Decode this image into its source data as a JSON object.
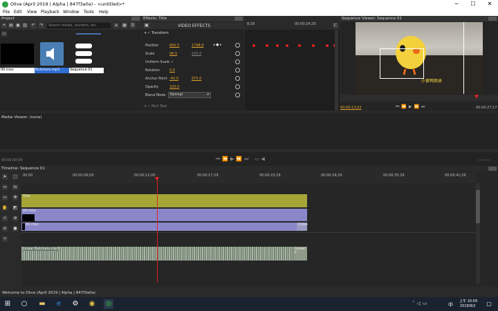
{
  "window": {
    "title": "Olive (April 2019 | Alpha | 847f3a0a) - <untitled>*",
    "minimize": "─",
    "maximize": "☐",
    "close": "✕"
  },
  "menu": [
    "File",
    "Edit",
    "View",
    "Playback",
    "Window",
    "Tools",
    "Help"
  ],
  "project": {
    "title": "Project",
    "search_placeholder": "Search media, markers, etc.",
    "items": [
      "00.mov",
      "Butchers.mp3",
      "Sequence 01"
    ]
  },
  "effects": {
    "title": "Effects: Title",
    "header": "VIDEO EFFECTS",
    "transform_label": "Transform",
    "rows": [
      {
        "label": "Position",
        "v1": "695.5",
        "v2": "1798.0"
      },
      {
        "label": "Scale",
        "v1": "96.5",
        "v2": "100.0"
      },
      {
        "label": "Uniform Scale",
        "v1": "✓",
        "v2": ""
      },
      {
        "label": "Rotation",
        "v1": "0.0",
        "v2": ""
      },
      {
        "label": "Anchor Point",
        "v1": "-40.0",
        "v2": "875.0"
      },
      {
        "label": "Opacity",
        "v1": "100.0",
        "v2": ""
      },
      {
        "label": "Blend Mode",
        "v1": "Normal",
        "v2": ""
      }
    ],
    "next_effect": "Rich Text",
    "ruler_start": "8;29",
    "ruler_mid": "00:00:24;29"
  },
  "sequence_viewer": {
    "title": "Sequence Viewer: Sequence 01",
    "current_time": "00:00:13;02",
    "end_time": "00:00:27;17",
    "caption": "小黄鸭图录"
  },
  "media_viewer": {
    "title": "Media Viewer: (none)",
    "time_left": "00:00:00;00",
    "time_right": "--:--:--:--"
  },
  "timeline": {
    "title": "Timeline: Sequence 01",
    "ruler": [
      "00:00",
      "00:00:06;00",
      "00:00:12;00",
      "00:00:17;29",
      "00:00:23;29",
      "00:00:29;29",
      "00:00:35;29",
      "00:00:41;29"
    ],
    "clips": {
      "title": "Title",
      "mov": "00.mov",
      "mov2": "00.mov",
      "cross": "Cross",
      "audio": "Linear Butchers.mp3",
      "audio_end": "Linear F"
    }
  },
  "status": "Welcome to Olive (April 2019 | Alpha | 847f3a0a)",
  "taskbar": {
    "time": "10:09",
    "ampm": "上午",
    "date": "2019/9/2",
    "lang": "中"
  },
  "colors": {
    "title_clip": "#a5a538",
    "video_clip": "#8a87c9",
    "audio_clip": "#8f9a8a",
    "playhead": "#d22222",
    "accent": "#e2a42b"
  }
}
